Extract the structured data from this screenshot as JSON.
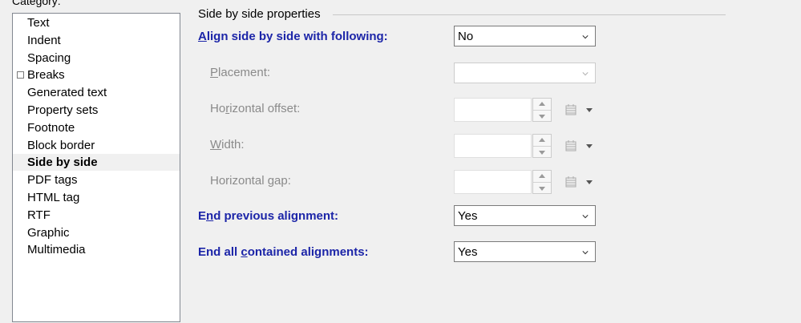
{
  "category": {
    "label": "Category:",
    "items": [
      {
        "label": "Text",
        "selected": false,
        "has_check": false
      },
      {
        "label": "Indent",
        "selected": false,
        "has_check": false
      },
      {
        "label": "Spacing",
        "selected": false,
        "has_check": false
      },
      {
        "label": "Breaks",
        "selected": false,
        "has_check": true
      },
      {
        "label": "Generated text",
        "selected": false,
        "has_check": false
      },
      {
        "label": "Property sets",
        "selected": false,
        "has_check": false
      },
      {
        "label": "Footnote",
        "selected": false,
        "has_check": false
      },
      {
        "label": "Block border",
        "selected": false,
        "has_check": false
      },
      {
        "label": "Side by side",
        "selected": true,
        "has_check": false
      },
      {
        "label": "PDF tags",
        "selected": false,
        "has_check": false
      },
      {
        "label": "HTML tag",
        "selected": false,
        "has_check": false
      },
      {
        "label": "RTF",
        "selected": false,
        "has_check": false
      },
      {
        "label": "Graphic",
        "selected": false,
        "has_check": false
      },
      {
        "label": "Multimedia",
        "selected": false,
        "has_check": false
      }
    ]
  },
  "group": {
    "title": "Side by side properties"
  },
  "fields": {
    "align": {
      "pre": "",
      "mn": "A",
      "post": "lign side by side with following:",
      "value": "No"
    },
    "placement": {
      "pre": "",
      "mn": "P",
      "post": "lacement:",
      "value": ""
    },
    "horizontal_offset": {
      "pre": "Ho",
      "mn": "r",
      "post": "izontal offset:",
      "value": ""
    },
    "width": {
      "pre": "",
      "mn": "W",
      "post": "idth:",
      "value": ""
    },
    "horizontal_gap": {
      "pre": "Horizontal ",
      "mn": "g",
      "post": "ap:",
      "value": ""
    },
    "end_previous": {
      "pre": "E",
      "mn": "n",
      "post": "d previous alignment:",
      "value": "Yes"
    },
    "end_all": {
      "pre": "End all ",
      "mn": "c",
      "post": "ontained alignments:",
      "value": "Yes"
    }
  },
  "colors": {
    "active_label": "#1c25a8",
    "disabled_label": "#8a8a8a",
    "selected_bg": "#f0f0f0"
  }
}
